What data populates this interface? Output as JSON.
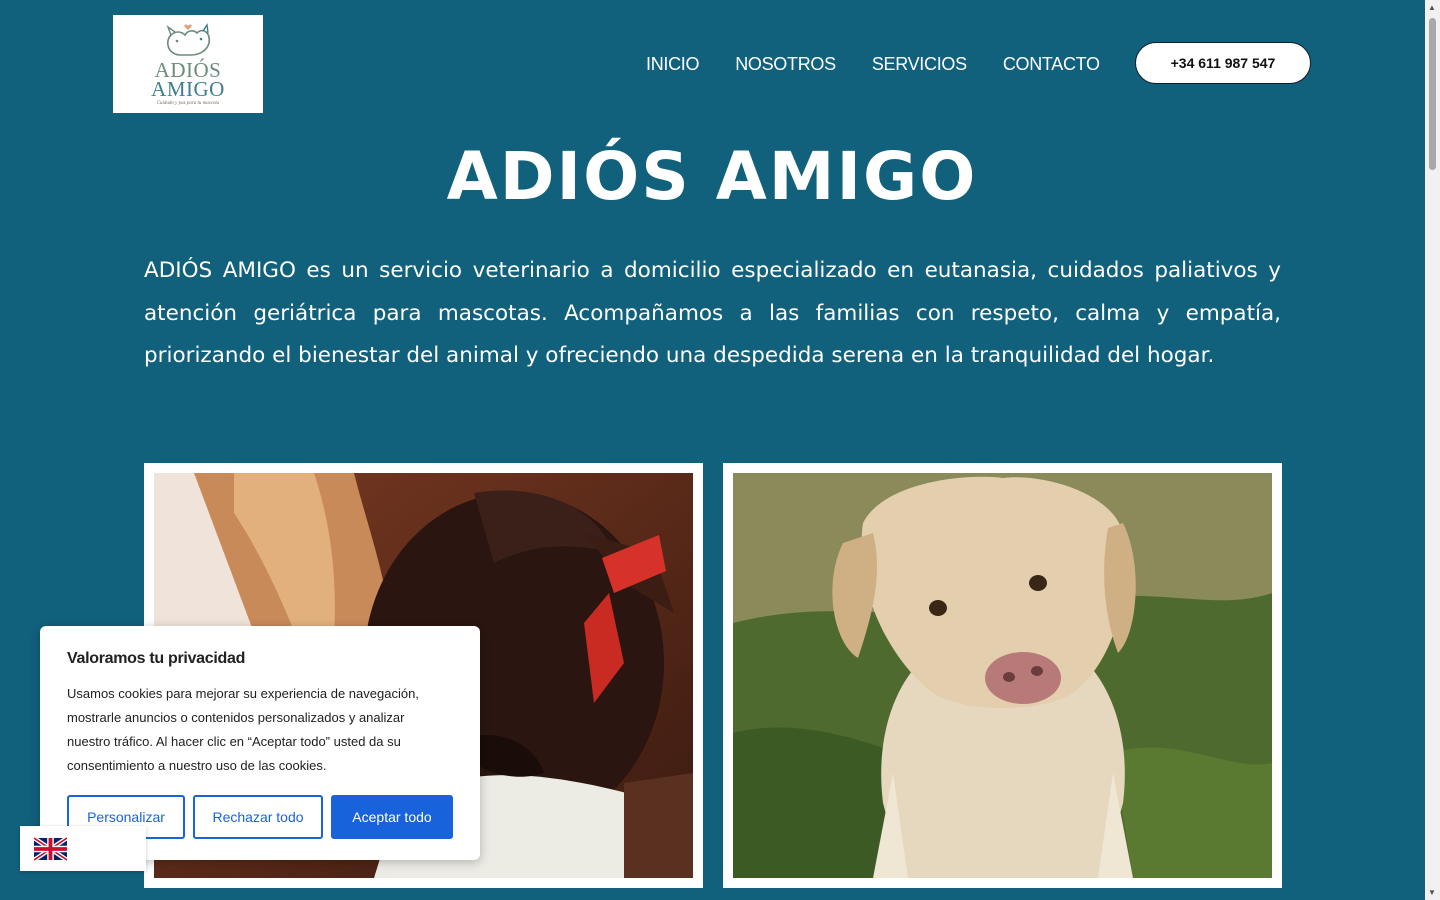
{
  "header": {
    "logo": {
      "line1": "ADIÓS",
      "line2": "AMIGO",
      "tagline": "Cuidado y paz para tu mascota"
    },
    "nav": [
      {
        "label": "INICIO"
      },
      {
        "label": "NOSOTROS"
      },
      {
        "label": "SERVICIOS"
      },
      {
        "label": "CONTACTO"
      }
    ],
    "phone": "+34 611 987 547"
  },
  "hero": {
    "title": "ADIÓS AMIGO",
    "description": "ADIÓS AMIGO es un servicio veterinario a domicilio especializado en eutanasia, cuidados paliativos y atención geriátrica para mascotas. Acompañamos a las familias con respeto, calma y empatía, priorizando el bienestar del animal y ofreciendo una despedida serena en la tranquilidad del hogar."
  },
  "photos": [
    {
      "subject": "brown-dog-resting-with-owner"
    },
    {
      "subject": "yellow-labrador-sitting-on-grass"
    }
  ],
  "cookie_banner": {
    "title": "Valoramos tu privacidad",
    "text": "Usamos cookies para mejorar su experiencia de navegación, mostrarle anuncios o contenidos personalizados y analizar nuestro tráfico. Al hacer clic en “Aceptar todo” usted da su consentimiento a nuestro uso de las cookies.",
    "buttons": {
      "customize": "Personalizar",
      "reject": "Rechazar todo",
      "accept": "Aceptar todo"
    }
  },
  "language_switcher": {
    "flag_icon": "uk-flag-icon"
  },
  "colors": {
    "background": "#11607c",
    "button_blue": "#1863dc",
    "text_white": "#ffffff"
  }
}
